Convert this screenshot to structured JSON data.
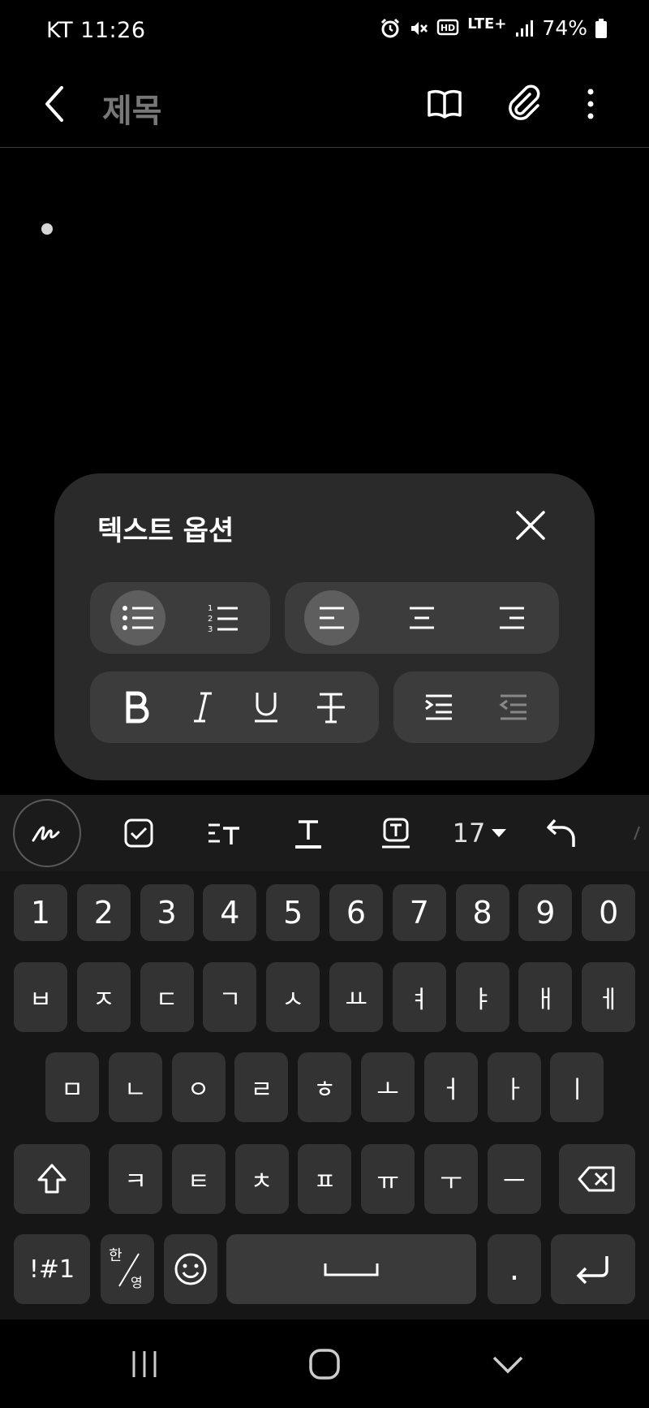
{
  "status": {
    "carrier_time": "KT 11:26",
    "network": "LTE+",
    "battery": "74%"
  },
  "header": {
    "title": "제목"
  },
  "text_options": {
    "title": "텍스트 옵션"
  },
  "toolbar": {
    "font_size": "17"
  },
  "keyboard": {
    "row_numbers": [
      "1",
      "2",
      "3",
      "4",
      "5",
      "6",
      "7",
      "8",
      "9",
      "0"
    ],
    "row1": [
      "ㅂ",
      "ㅈ",
      "ㄷ",
      "ㄱ",
      "ㅅ",
      "ㅛ",
      "ㅕ",
      "ㅑ",
      "ㅐ",
      "ㅔ"
    ],
    "row2": [
      "ㅁ",
      "ㄴ",
      "ㅇ",
      "ㄹ",
      "ㅎ",
      "ㅗ",
      "ㅓ",
      "ㅏ",
      "ㅣ"
    ],
    "row3": [
      "ㅋ",
      "ㅌ",
      "ㅊ",
      "ㅍ",
      "ㅠ",
      "ㅜ",
      "ㅡ"
    ],
    "symbols_label": "!#1",
    "lang_top": "한",
    "lang_bottom": "영",
    "period": "."
  }
}
